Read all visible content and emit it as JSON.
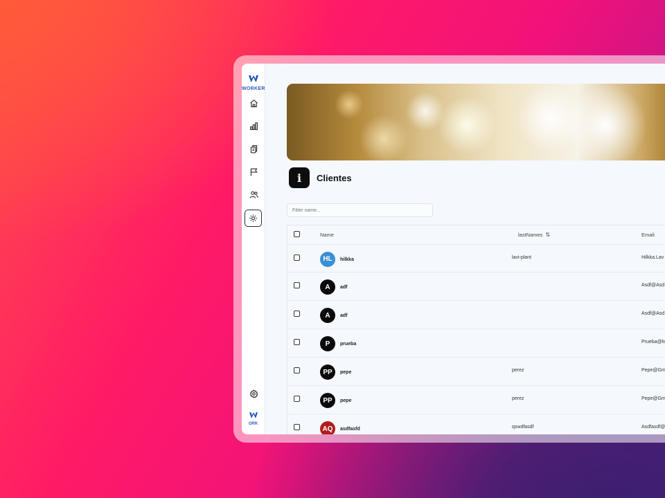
{
  "app": {
    "logo_text": "WORKER",
    "logo_text_small": "ORK"
  },
  "sidebar": {
    "items": [
      {
        "name": "home",
        "icon": "home-icon"
      },
      {
        "name": "stats",
        "icon": "bar-chart-icon"
      },
      {
        "name": "documents",
        "icon": "documents-icon"
      },
      {
        "name": "flags",
        "icon": "flag-icon"
      },
      {
        "name": "users",
        "icon": "users-icon"
      },
      {
        "name": "active-sun",
        "icon": "sun-icon",
        "active": true
      }
    ],
    "footer": {
      "settings_icon": "gear-icon"
    }
  },
  "page": {
    "title": "Clientes",
    "badge": "i"
  },
  "filter": {
    "placeholder": "Filter name..."
  },
  "table": {
    "headers": {
      "name": "Name",
      "lastnames": "lastNames",
      "email": "Email"
    },
    "rows": [
      {
        "initials": "HL",
        "avatar_color": "#3b8fd3",
        "name": "hilkka",
        "lastname": "lavi-plant",
        "email": "Hilkka.Lav"
      },
      {
        "initials": "A",
        "avatar_color": "#0a0a0a",
        "name": "adf",
        "lastname": "",
        "email": "Asdf@Asd"
      },
      {
        "initials": "A",
        "avatar_color": "#0a0a0a",
        "name": "adf",
        "lastname": "",
        "email": "Asdf@Asd"
      },
      {
        "initials": "P",
        "avatar_color": "#0a0a0a",
        "name": "prueba",
        "lastname": "",
        "email": "Prueba@M"
      },
      {
        "initials": "PP",
        "avatar_color": "#0a0a0a",
        "name": "pepe",
        "lastname": "perez",
        "email": "Pepe@Gm"
      },
      {
        "initials": "PP",
        "avatar_color": "#0a0a0a",
        "name": "pepe",
        "lastname": "perez",
        "email": "Pepe@Gm"
      },
      {
        "initials": "AQ",
        "avatar_color": "#b01c1c",
        "name": "asdfasfd",
        "lastname": "qswdfasdf",
        "email": "Asdfasdf@"
      }
    ]
  }
}
